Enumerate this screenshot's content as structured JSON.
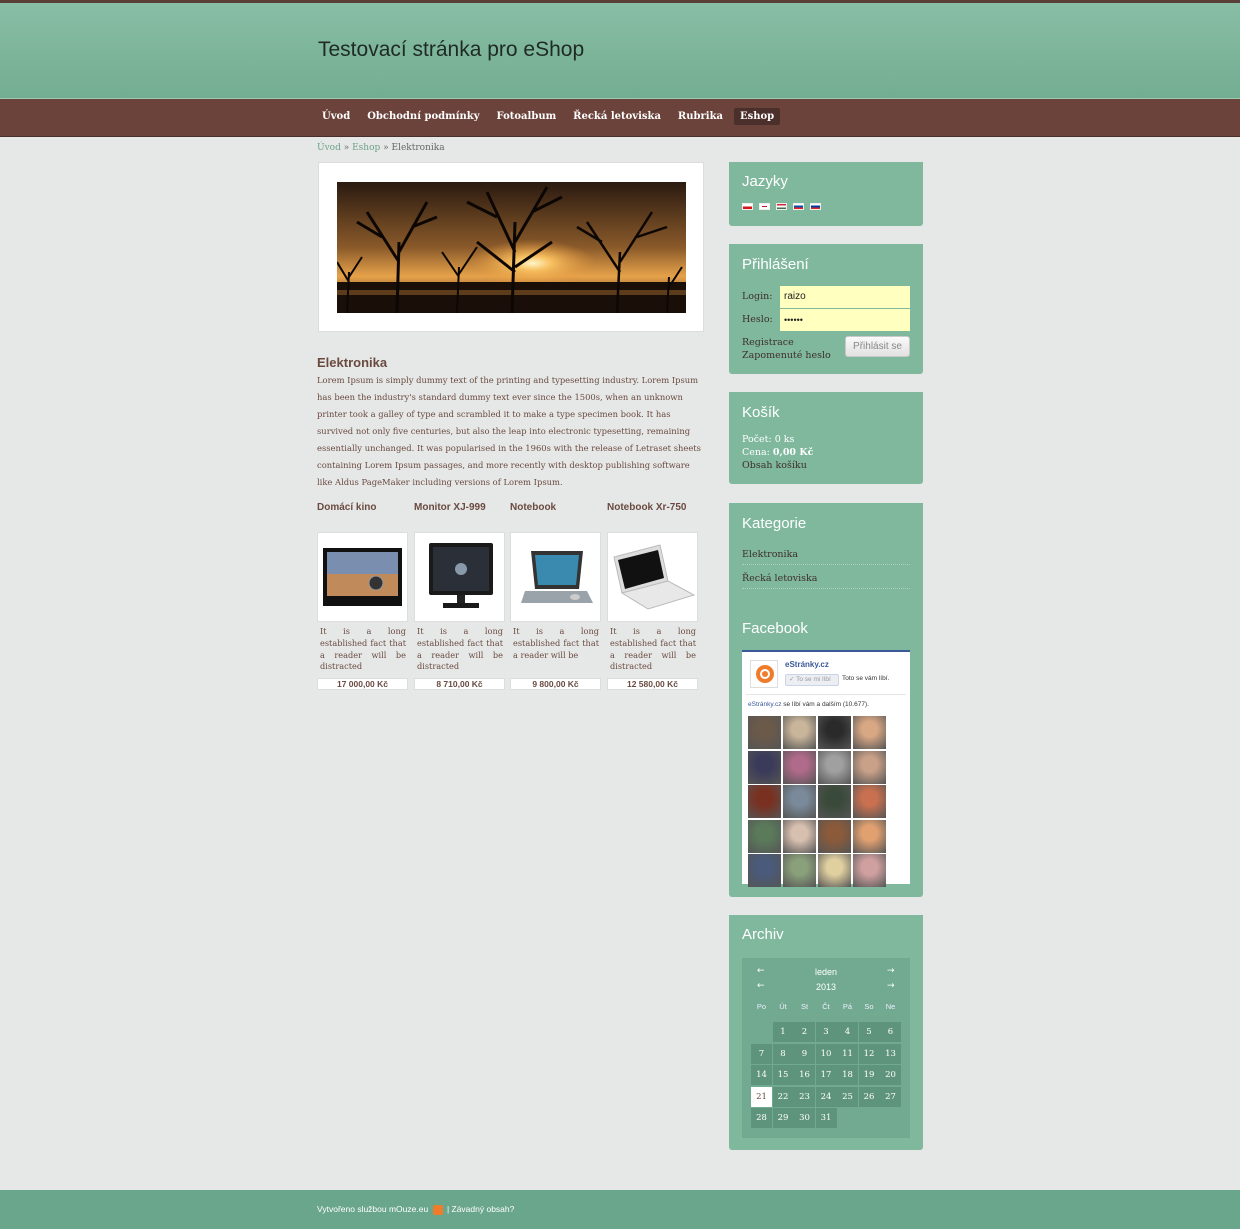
{
  "header": {
    "title": "Testovací stránka pro eShop"
  },
  "nav": {
    "items": [
      "Úvod",
      "Obchodní podmínky",
      "Fotoalbum",
      "Řecká letoviska",
      "Rubrika",
      "Eshop"
    ],
    "active": "Eshop"
  },
  "breadcrumb": {
    "home": "Úvod",
    "sep1": " » ",
    "shop": "Eshop",
    "sep2": " » ",
    "current": "Elektronika"
  },
  "category": {
    "title": "Elektronika",
    "text": "Lorem Ipsum is simply dummy text of the printing and typesetting industry. Lorem Ipsum has been the industry's standard dummy text ever since the 1500s, when an unknown printer took a galley of type and scrambled it to make a type specimen book. It has survived not only five centuries, but also the leap into electronic typesetting, remaining essentially unchanged. It was popularised in the 1960s with the release of Letraset sheets containing Lorem Ipsum passages, and more recently with desktop publishing software like Aldus PageMaker including versions of Lorem Ipsum."
  },
  "products": [
    {
      "name": "Domácí kino",
      "desc": "It is a long established fact that a reader will be distracted",
      "price": "17 000,00 Kč"
    },
    {
      "name": "Monitor XJ-999",
      "desc": "It is a long established fact that a reader will be distracted",
      "price": "8 710,00 Kč"
    },
    {
      "name": "Notebook",
      "desc": "It is a long established fact that a reader will be",
      "price": "9 800,00 Kč"
    },
    {
      "name": "Notebook Xr-750",
      "desc": "It is a long established fact that a reader will be distracted",
      "price": "12 580,00 Kč"
    }
  ],
  "sidebar": {
    "languages": {
      "title": "Jazyky",
      "flags": [
        "cz-flag-icon",
        "gb-flag-icon",
        "hu-flag-icon",
        "sk-flag-icon",
        "ru-flag-icon"
      ]
    },
    "login": {
      "title": "Přihlášení",
      "login_label": "Login:",
      "login_value": "raizo",
      "password_label": "Heslo:",
      "password_value": "••••••",
      "register": "Registrace",
      "forgot": "Zapomenuté heslo",
      "button": "Přihlásit se"
    },
    "cart": {
      "title": "Košík",
      "count_label": "Počet:",
      "count": "0 ks",
      "price_label": "Cena:",
      "price": "0,00 Kč",
      "contents": "Obsah košíku"
    },
    "categories": {
      "title": "Kategorie",
      "items": [
        "Elektronika",
        "Řecká letoviska"
      ]
    },
    "facebook": {
      "title": "Facebook",
      "page_name": "eStránky.cz",
      "like_button": "✓ To se mi líbí",
      "like_text": "Toto se vám líbí.",
      "count_link": "eStránky.cz",
      "count_text": " se líbí vám a dalším (10.677)."
    },
    "archive": {
      "title": "Archiv",
      "month": "leden",
      "year": "2013",
      "prev_arrow": "←",
      "next_arrow": "→",
      "days_of_week": [
        "Po",
        "Út",
        "St",
        "Čt",
        "Pá",
        "So",
        "Ne"
      ],
      "days": [
        "1",
        "2",
        "3",
        "4",
        "5",
        "6",
        "7",
        "8",
        "9",
        "10",
        "11",
        "12",
        "13",
        "14",
        "15",
        "16",
        "17",
        "18",
        "19",
        "20",
        "21",
        "22",
        "23",
        "24",
        "25",
        "26",
        "27",
        "28",
        "29",
        "30",
        "31"
      ],
      "today": "21"
    }
  },
  "footer": {
    "created": "Vytvořeno službou mOuze.eu",
    "separator": " | ",
    "report": "Závadný obsah?"
  }
}
